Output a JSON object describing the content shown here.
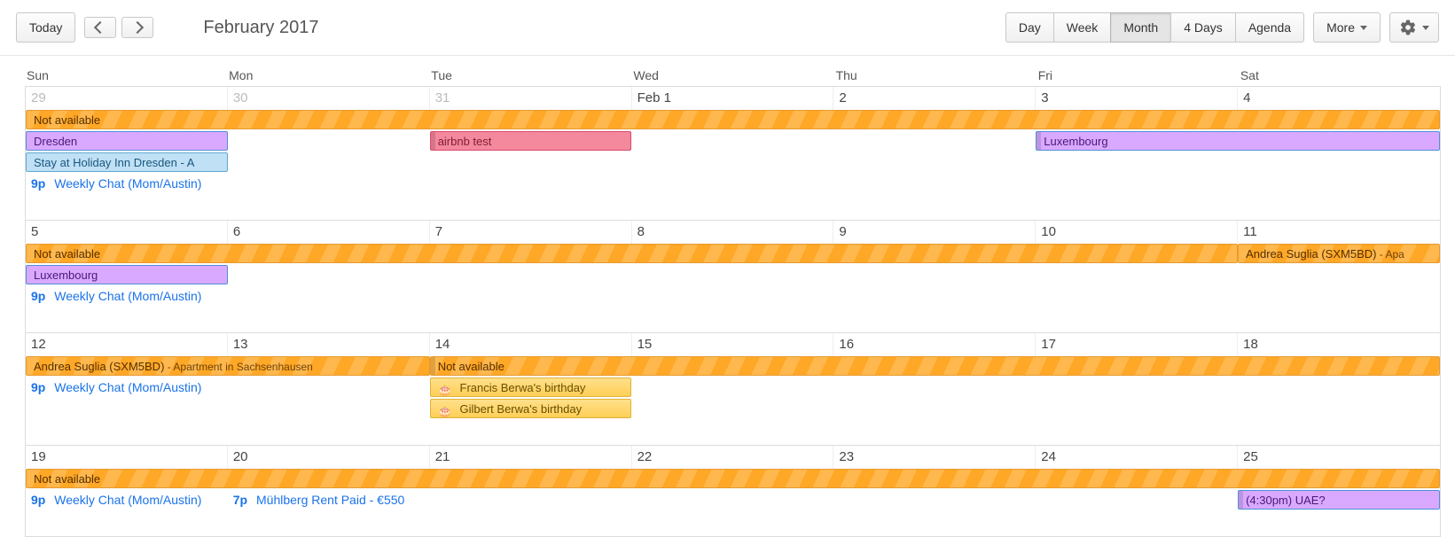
{
  "toolbar": {
    "today": "Today",
    "title": "February 2017",
    "views": {
      "day": "Day",
      "week": "Week",
      "month": "Month",
      "days4": "4 Days",
      "agenda": "Agenda"
    },
    "more": "More"
  },
  "dow": [
    "Sun",
    "Mon",
    "Tue",
    "Wed",
    "Thu",
    "Fri",
    "Sat"
  ],
  "weeks": [
    {
      "dates": [
        "29",
        "30",
        "31",
        "Feb 1",
        "2",
        "3",
        "4"
      ],
      "other_month": [
        0,
        1,
        2
      ]
    },
    {
      "dates": [
        "5",
        "6",
        "7",
        "8",
        "9",
        "10",
        "11"
      ],
      "other_month": []
    },
    {
      "dates": [
        "12",
        "13",
        "14",
        "15",
        "16",
        "17",
        "18"
      ],
      "other_month": []
    },
    {
      "dates": [
        "19",
        "20",
        "21",
        "22",
        "23",
        "24",
        "25"
      ],
      "other_month": []
    }
  ],
  "events": {
    "not_available": "Not available",
    "dresden": "Dresden",
    "holiday_inn": "Stay at Holiday Inn Dresden - A",
    "weekly_chat_time": "9p",
    "weekly_chat": "Weekly Chat (Mom/Austin)",
    "airbnb_test": "airbnb test",
    "luxembourg": "Luxembourg",
    "andrea_main": "Andrea Suglia (SXM5BD)",
    "andrea_sub": " - Apartment in Sachsenhausen",
    "andrea_sub_short": " - Apa",
    "francis_bday": "Francis Berwa's birthday",
    "gilbert_bday": "Gilbert Berwa's birthday",
    "muhlberg_time": "7p",
    "muhlberg": "Mühlberg Rent Paid - €550",
    "uae": "(4:30pm) UAE?"
  }
}
